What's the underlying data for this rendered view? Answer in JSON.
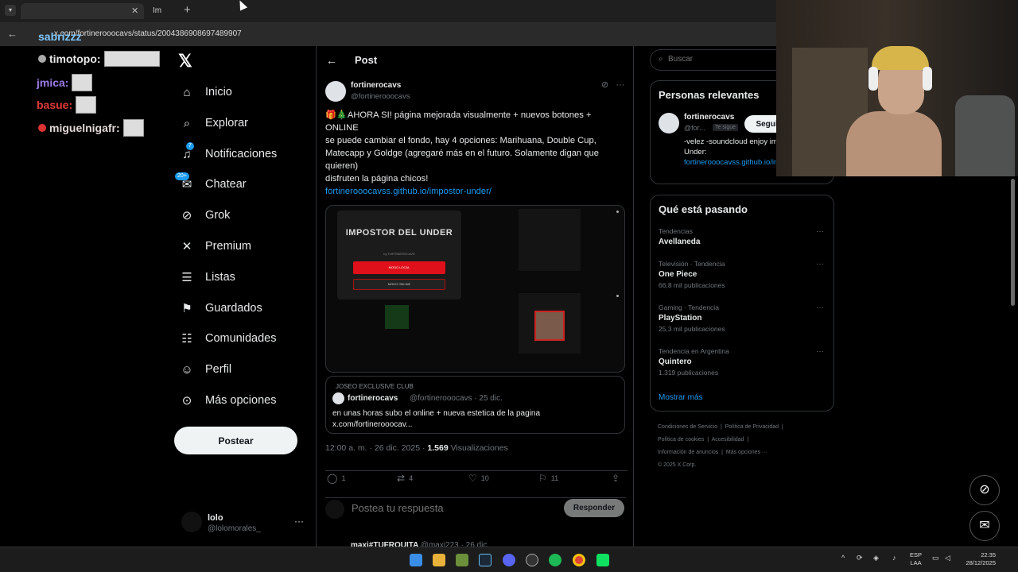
{
  "browser": {
    "tab1_title": "",
    "tab2_title": "Im",
    "tab_close": "✕",
    "new_tab": "+",
    "url": "x.com/fortinerooocavs/status/2004386908697489907"
  },
  "chat": {
    "messages": [
      {
        "user": "timotopo:",
        "color": "#e8e8e8"
      },
      {
        "user": "jmica:",
        "color": "#9b7be8"
      },
      {
        "user": "basue:",
        "color": "#e23a3a"
      },
      {
        "user": "miguelnigafr:",
        "color": "#e3d7d7"
      }
    ],
    "top_user": "sabrizzz"
  },
  "sidebar": {
    "items": [
      {
        "label": "Inicio",
        "icon": "home-icon"
      },
      {
        "label": "Explorar",
        "icon": "search-icon"
      },
      {
        "label": "Notificaciones",
        "icon": "bell-icon",
        "badge": "7"
      },
      {
        "label": "Chatear",
        "icon": "mail-icon",
        "badge": "20+"
      },
      {
        "label": "Grok",
        "icon": "grok-icon"
      },
      {
        "label": "Premium",
        "icon": "x-icon"
      },
      {
        "label": "Listas",
        "icon": "list-icon"
      },
      {
        "label": "Guardados",
        "icon": "bookmark-icon"
      },
      {
        "label": "Comunidades",
        "icon": "people-icon"
      },
      {
        "label": "Perfil",
        "icon": "person-icon"
      },
      {
        "label": "Más opciones",
        "icon": "more-icon"
      }
    ],
    "post_button": "Postear",
    "account": {
      "name": "lolo",
      "handle": "@lolomorales_"
    }
  },
  "header": {
    "title": "Post"
  },
  "post": {
    "author_name": "fortinerocavs",
    "author_handle": "@fortinerooocavs",
    "text_line1": "🎁🎄AHORA SI! página mejorada visualmente + nuevos botones + ONLINE",
    "text_line2": "se puede cambiar el fondo, hay 4 opciones: Marihuana, Double Cup, Matecapp y Goldge (agregaré más en el futuro. Solamente digan que quieren)",
    "text_line3": "disfruten la página chicos!",
    "link": "fortinerooocavss.github.io/impostor-under/",
    "media": {
      "title": "IMPOSTOR DEL UNDER",
      "by": "by FORTINEROCAVS",
      "btn_local": "MODO LOCAL",
      "btn_online": "MODO ONLINE"
    },
    "quote": {
      "context": "JOSEO EXCLUSIVE CLUB",
      "author": "fortinerocavs",
      "meta": "@fortinerooocavs · 25 dic.",
      "text": "en unas horas subo el online + nueva estetica de la pagina x.com/fortinerooocav..."
    },
    "time": "12:00 a. m. · 26 dic. 2025 · ",
    "views": "1.569",
    "views_label": " Visualizaciones",
    "stats": {
      "replies": "1",
      "reposts": "4",
      "likes": "10",
      "bookmarks": "11"
    }
  },
  "reply": {
    "placeholder": "Postea tu respuesta",
    "button": "Responder"
  },
  "next_post": {
    "author": "maxi#TUFROUITA",
    "meta": "@maxi223 · 26 dic."
  },
  "right": {
    "search_placeholder": "Buscar",
    "relevant_title": "Personas relevantes",
    "relevant": {
      "name": "fortinerocavs",
      "handle": "@for...",
      "badge": "Te sigue",
      "follow": "Seguir",
      "bio": "-velez -soundcloud enjoy impostor del Under:",
      "bio_link": "fortinerooocavss.github.io/impostor-under/"
    },
    "trends_title": "Qué está pasando",
    "trends": [
      {
        "category": "Tendencias",
        "name": "Avellaneda",
        "count": ""
      },
      {
        "category": "Televisión · Tendencia",
        "name": "One Piece",
        "count": "66,8 mil publicaciones"
      },
      {
        "category": "Gaming · Tendencia",
        "name": "PlayStation",
        "count": "25,3 mil publicaciones"
      },
      {
        "category": "Tendencia en Argentina",
        "name": "Quintero",
        "count": "1.319 publicaciones"
      }
    ],
    "show_more": "Mostrar más",
    "footer": [
      "Condiciones de Servicio",
      "Política de Privacidad",
      "Política de cookies",
      "Accesibilidad",
      "Información de anuncios",
      "Más opciones ···",
      "© 2025 X Corp."
    ]
  },
  "taskbar": {
    "lang1": "ESP",
    "lang2": "LAA",
    "time": "22:35",
    "date": "28/12/2025"
  },
  "colors": {
    "accent": "#1d9bf0",
    "background": "#000000",
    "border": "#2f3336",
    "muted": "#71767b"
  }
}
